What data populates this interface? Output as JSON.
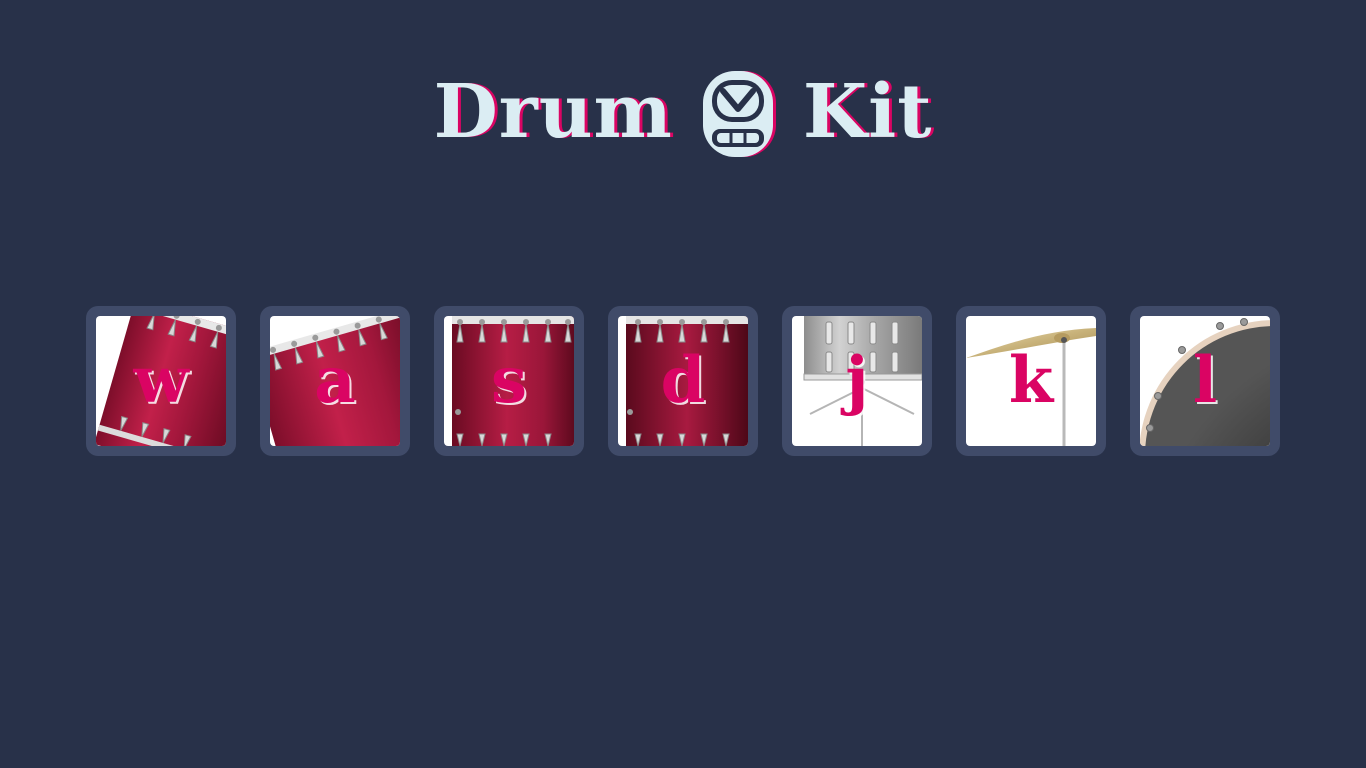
{
  "header": {
    "title_part1": "Drum",
    "title_part2": "Kit",
    "logo_icon": "drum-face-icon"
  },
  "colors": {
    "background": "#283149",
    "tile": "#404b69",
    "title": "#dbedf3",
    "accent": "#da0463"
  },
  "drums": [
    {
      "key": "w",
      "image": "tom-drum-tilted-icon"
    },
    {
      "key": "a",
      "image": "tom-drum-tilted-icon"
    },
    {
      "key": "s",
      "image": "tom-drum-icon"
    },
    {
      "key": "d",
      "image": "tom-drum-icon"
    },
    {
      "key": "j",
      "image": "snare-drum-icon"
    },
    {
      "key": "k",
      "image": "crash-cymbal-icon"
    },
    {
      "key": "l",
      "image": "kick-drum-icon"
    }
  ]
}
